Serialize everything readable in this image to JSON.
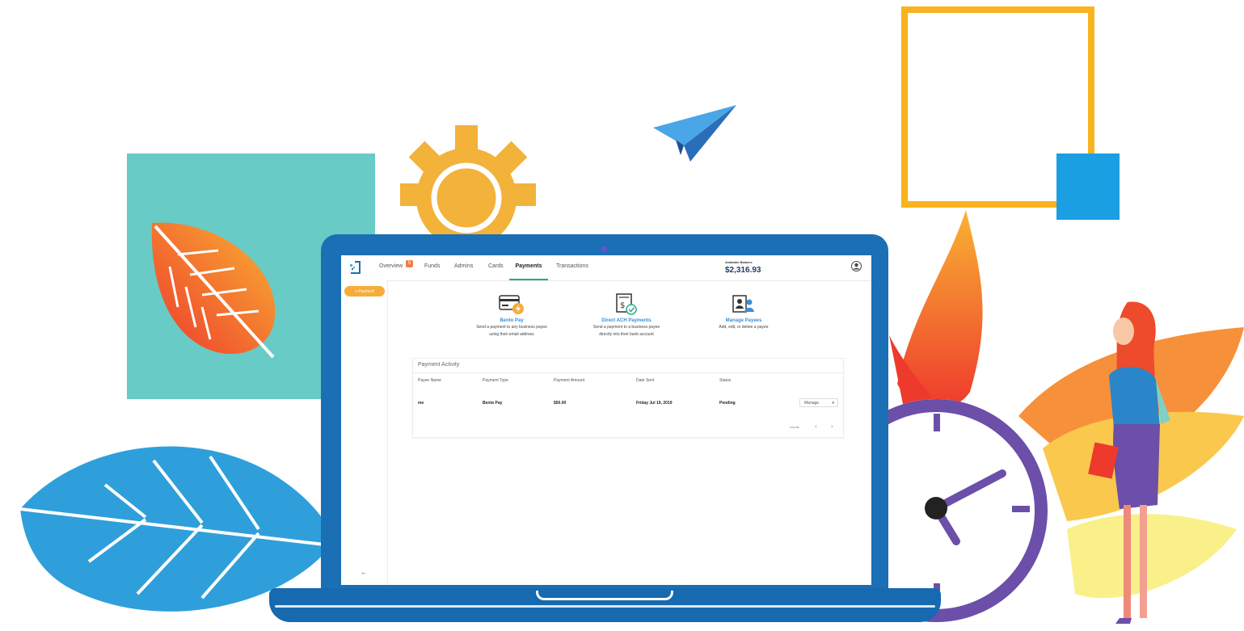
{
  "scene": {
    "colors": {
      "teal": "#69cbc5",
      "yellow": "#f9b31e",
      "blue": "#1b9fe3",
      "laptop": "#1b6fb5",
      "orange": "#f47d42",
      "red": "#ee3a2c",
      "purple": "#6b4fa8"
    }
  },
  "app": {
    "nav": {
      "tabs": [
        {
          "label": "Overview"
        },
        {
          "label": "Funds"
        },
        {
          "label": "Admins"
        },
        {
          "label": "Cards"
        },
        {
          "label": "Payments"
        },
        {
          "label": "Transactions"
        }
      ],
      "active_tab": "Payments",
      "overview_badge": "5"
    },
    "balance": {
      "label": "Available Balance",
      "value": "$2,316.93"
    },
    "sidebar": {
      "add_payment_label": "+ Payment"
    },
    "options": [
      {
        "title": "Bento Pay",
        "desc_line1": "Send a payment to any business payee",
        "desc_line2": "using their email address",
        "icon": "card-lightning-icon"
      },
      {
        "title": "Direct ACH Payments",
        "desc_line1": "Send a payment to a business payee",
        "desc_line2": "directly into their bank account",
        "icon": "check-document-icon"
      },
      {
        "title": "Manage Payees",
        "desc_line1": "Add, edit, or delete a payee",
        "desc_line2": "",
        "icon": "payees-icon"
      }
    ],
    "activity": {
      "title": "Payment Activity",
      "columns": [
        "Payee Name",
        "Payment Type",
        "Payment Amount",
        "Date Sent",
        "Status"
      ],
      "rows": [
        {
          "payee": "me",
          "type": "Bento Pay",
          "amount": "$50.00",
          "date": "Friday Jul 19, 2019",
          "status": "Pending",
          "action": "Manage"
        }
      ],
      "pager_label": "results"
    }
  }
}
